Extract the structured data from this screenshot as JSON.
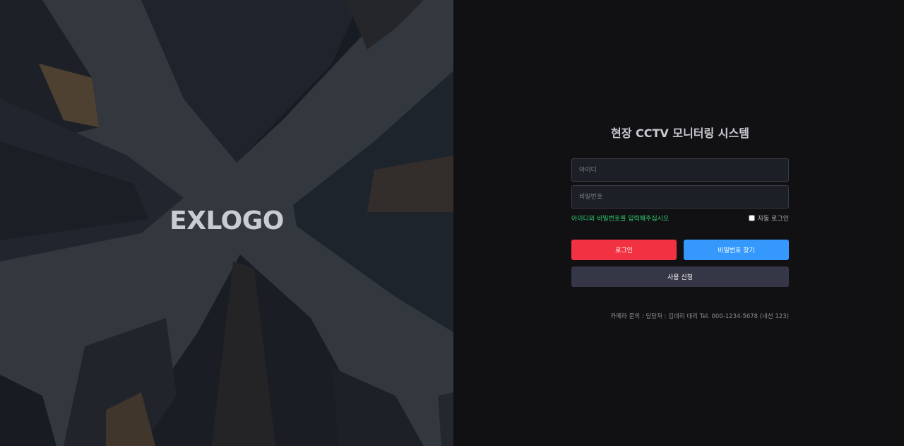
{
  "hero": {
    "logo_text": "EXLOGO"
  },
  "login": {
    "title": "현장 CCTV 모니터링 시스템",
    "id_placeholder": "아이디",
    "password_placeholder": "비밀번호",
    "hint_text": "아이디와 비밀번호를 입력해주십시오",
    "auto_login_label": "자동 로그인",
    "login_button": "로그인",
    "find_password_button": "비밀번호 찾기",
    "apply_button": "사용 신청",
    "contact_text": "카메라 문의 : 담당자 : 김대리 대리 Tel. 000-1234-5678 (내선 123)"
  },
  "colors": {
    "login_button": "#f23242",
    "find_password_button": "#3498fd",
    "apply_button": "#353747",
    "hint": "#2ecc71",
    "panel_background": "#111114"
  }
}
